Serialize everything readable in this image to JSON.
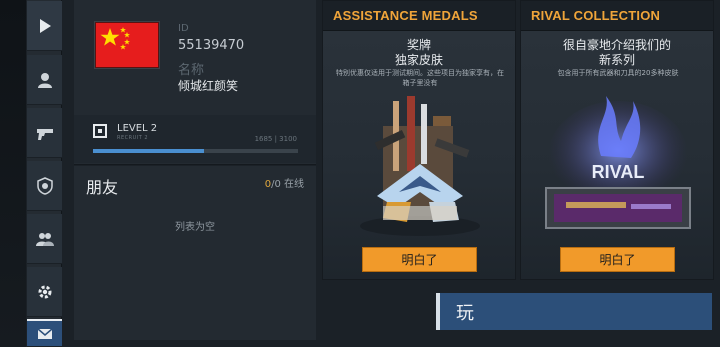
{
  "sidebar": {
    "items": [
      {
        "name": "play",
        "icon": "play-icon"
      },
      {
        "name": "profile",
        "icon": "person-icon"
      },
      {
        "name": "weapons",
        "icon": "pistol-icon"
      },
      {
        "name": "clan",
        "icon": "shield-icon"
      },
      {
        "name": "friends",
        "icon": "group-icon"
      },
      {
        "name": "settings",
        "icon": "gear-icon"
      },
      {
        "name": "mail",
        "icon": "mail-icon"
      }
    ]
  },
  "profile": {
    "flag": "china-flag",
    "id_label": "ID",
    "id_value": "55139470",
    "name_label": "名称",
    "name_value": "倾城红颜笑",
    "level_title": "LEVEL 2",
    "level_sub": "RECRUIT 2",
    "xp_text": "1685 | 3100",
    "xp_fraction": 0.5435
  },
  "friends": {
    "title": "朋友",
    "count_online": "0",
    "count_rest": "/0 在线",
    "empty_text": "列表为空"
  },
  "cards": {
    "assistance": {
      "title": "ASSISTANCE MEDALS",
      "line1": "奖牌",
      "line2": "独家皮肤",
      "desc": "特别优惠仅适用于测试期间。这些项目为独家享有，在箱子里没有",
      "button": "明白了"
    },
    "rival": {
      "title": "RIVAL COLLECTION",
      "line1": "很自豪地介绍我们的",
      "line2": "新系列",
      "desc": "包含用于所有武器和刀具的20多种皮肤",
      "art_text": "RIVAL",
      "button": "明白了"
    }
  },
  "play_button": "玩",
  "colors": {
    "accent_orange": "#f19a2a",
    "title_orange": "#f0a53a",
    "play_blue": "#2c4f79",
    "xp_blue": "#4a8fd0"
  }
}
